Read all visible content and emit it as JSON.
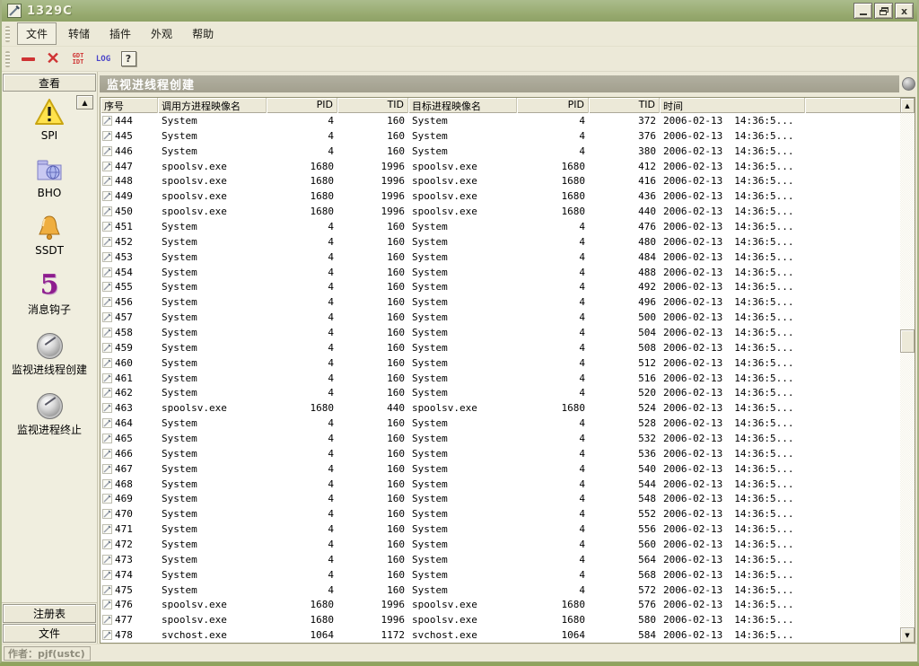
{
  "window": {
    "title": "1329C",
    "controls": {
      "minimize": "minimize",
      "restore": "restore",
      "close": "close"
    }
  },
  "menu": {
    "items": [
      "文件",
      "转储",
      "插件",
      "外观",
      "帮助"
    ]
  },
  "toolbar": {
    "buttons": [
      {
        "name": "dash-tool",
        "glyph": "—"
      },
      {
        "name": "delete-tool",
        "glyph": "×"
      },
      {
        "name": "gdt-idt-tool",
        "line1": "GDT",
        "line2": "IDT"
      },
      {
        "name": "log-tool",
        "label": "LOG"
      },
      {
        "name": "help-tool",
        "label": "?"
      }
    ]
  },
  "sidebar": {
    "header": "查看",
    "items": [
      {
        "label": "SPI",
        "icon": "warning-triangle-icon"
      },
      {
        "label": "BHO",
        "icon": "folder-globe-icon"
      },
      {
        "label": "SSDT",
        "icon": "bell-icon"
      },
      {
        "label": "消息钩子",
        "icon": "purple-hook-icon",
        "glyph": "5"
      },
      {
        "label": "监视进线程创建",
        "icon": "round-metal-button-icon"
      },
      {
        "label": "监视进程终止",
        "icon": "round-metal-button-icon"
      }
    ],
    "bottom_buttons": [
      "注册表",
      "文件"
    ]
  },
  "panel": {
    "title": "监视进线程创建"
  },
  "table": {
    "columns": [
      {
        "label": "序号"
      },
      {
        "label": "调用方进程映像名"
      },
      {
        "label": "PID"
      },
      {
        "label": "TID"
      },
      {
        "label": "目标进程映像名"
      },
      {
        "label": "PID"
      },
      {
        "label": "TID"
      },
      {
        "label": "时间"
      },
      {
        "label": ""
      }
    ],
    "rows": [
      [
        "444",
        "System",
        "4",
        "160",
        "System",
        "4",
        "372",
        "2006-02-13",
        "14:36:5..."
      ],
      [
        "445",
        "System",
        "4",
        "160",
        "System",
        "4",
        "376",
        "2006-02-13",
        "14:36:5..."
      ],
      [
        "446",
        "System",
        "4",
        "160",
        "System",
        "4",
        "380",
        "2006-02-13",
        "14:36:5..."
      ],
      [
        "447",
        "spoolsv.exe",
        "1680",
        "1996",
        "spoolsv.exe",
        "1680",
        "412",
        "2006-02-13",
        "14:36:5..."
      ],
      [
        "448",
        "spoolsv.exe",
        "1680",
        "1996",
        "spoolsv.exe",
        "1680",
        "416",
        "2006-02-13",
        "14:36:5..."
      ],
      [
        "449",
        "spoolsv.exe",
        "1680",
        "1996",
        "spoolsv.exe",
        "1680",
        "436",
        "2006-02-13",
        "14:36:5..."
      ],
      [
        "450",
        "spoolsv.exe",
        "1680",
        "1996",
        "spoolsv.exe",
        "1680",
        "440",
        "2006-02-13",
        "14:36:5..."
      ],
      [
        "451",
        "System",
        "4",
        "160",
        "System",
        "4",
        "476",
        "2006-02-13",
        "14:36:5..."
      ],
      [
        "452",
        "System",
        "4",
        "160",
        "System",
        "4",
        "480",
        "2006-02-13",
        "14:36:5..."
      ],
      [
        "453",
        "System",
        "4",
        "160",
        "System",
        "4",
        "484",
        "2006-02-13",
        "14:36:5..."
      ],
      [
        "454",
        "System",
        "4",
        "160",
        "System",
        "4",
        "488",
        "2006-02-13",
        "14:36:5..."
      ],
      [
        "455",
        "System",
        "4",
        "160",
        "System",
        "4",
        "492",
        "2006-02-13",
        "14:36:5..."
      ],
      [
        "456",
        "System",
        "4",
        "160",
        "System",
        "4",
        "496",
        "2006-02-13",
        "14:36:5..."
      ],
      [
        "457",
        "System",
        "4",
        "160",
        "System",
        "4",
        "500",
        "2006-02-13",
        "14:36:5..."
      ],
      [
        "458",
        "System",
        "4",
        "160",
        "System",
        "4",
        "504",
        "2006-02-13",
        "14:36:5..."
      ],
      [
        "459",
        "System",
        "4",
        "160",
        "System",
        "4",
        "508",
        "2006-02-13",
        "14:36:5..."
      ],
      [
        "460",
        "System",
        "4",
        "160",
        "System",
        "4",
        "512",
        "2006-02-13",
        "14:36:5..."
      ],
      [
        "461",
        "System",
        "4",
        "160",
        "System",
        "4",
        "516",
        "2006-02-13",
        "14:36:5..."
      ],
      [
        "462",
        "System",
        "4",
        "160",
        "System",
        "4",
        "520",
        "2006-02-13",
        "14:36:5..."
      ],
      [
        "463",
        "spoolsv.exe",
        "1680",
        "440",
        "spoolsv.exe",
        "1680",
        "524",
        "2006-02-13",
        "14:36:5..."
      ],
      [
        "464",
        "System",
        "4",
        "160",
        "System",
        "4",
        "528",
        "2006-02-13",
        "14:36:5..."
      ],
      [
        "465",
        "System",
        "4",
        "160",
        "System",
        "4",
        "532",
        "2006-02-13",
        "14:36:5..."
      ],
      [
        "466",
        "System",
        "4",
        "160",
        "System",
        "4",
        "536",
        "2006-02-13",
        "14:36:5..."
      ],
      [
        "467",
        "System",
        "4",
        "160",
        "System",
        "4",
        "540",
        "2006-02-13",
        "14:36:5..."
      ],
      [
        "468",
        "System",
        "4",
        "160",
        "System",
        "4",
        "544",
        "2006-02-13",
        "14:36:5..."
      ],
      [
        "469",
        "System",
        "4",
        "160",
        "System",
        "4",
        "548",
        "2006-02-13",
        "14:36:5..."
      ],
      [
        "470",
        "System",
        "4",
        "160",
        "System",
        "4",
        "552",
        "2006-02-13",
        "14:36:5..."
      ],
      [
        "471",
        "System",
        "4",
        "160",
        "System",
        "4",
        "556",
        "2006-02-13",
        "14:36:5..."
      ],
      [
        "472",
        "System",
        "4",
        "160",
        "System",
        "4",
        "560",
        "2006-02-13",
        "14:36:5..."
      ],
      [
        "473",
        "System",
        "4",
        "160",
        "System",
        "4",
        "564",
        "2006-02-13",
        "14:36:5..."
      ],
      [
        "474",
        "System",
        "4",
        "160",
        "System",
        "4",
        "568",
        "2006-02-13",
        "14:36:5..."
      ],
      [
        "475",
        "System",
        "4",
        "160",
        "System",
        "4",
        "572",
        "2006-02-13",
        "14:36:5..."
      ],
      [
        "476",
        "spoolsv.exe",
        "1680",
        "1996",
        "spoolsv.exe",
        "1680",
        "576",
        "2006-02-13",
        "14:36:5..."
      ],
      [
        "477",
        "spoolsv.exe",
        "1680",
        "1996",
        "spoolsv.exe",
        "1680",
        "580",
        "2006-02-13",
        "14:36:5..."
      ],
      [
        "478",
        "svchost.exe",
        "1064",
        "1172",
        "svchost.exe",
        "1064",
        "584",
        "2006-02-13",
        "14:36:5..."
      ]
    ]
  },
  "statusbar": {
    "author": "作者：pjf(ustc)"
  },
  "colors": {
    "titlebar_green": "#96A96E",
    "panel_header": "#A8A695",
    "toolbar_red": "#CF3333",
    "toolbar_blue": "#4943C9",
    "hook_purple": "#8E1D8E",
    "taskbar_green": "#8FA35C",
    "background_cream": "#ECE9D8"
  }
}
